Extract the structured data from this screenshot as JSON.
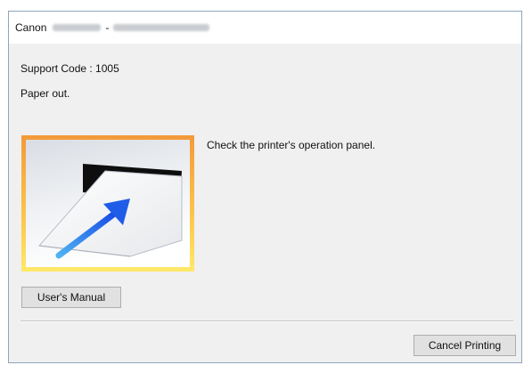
{
  "window": {
    "title_brand": "Canon",
    "title_separator": "-"
  },
  "dialog": {
    "support_code": "Support Code : 1005",
    "status_message": "Paper out.",
    "instruction": "Check the printer's operation panel.",
    "illustration_icon": "paper-feed-icon"
  },
  "buttons": {
    "users_manual": "User's Manual",
    "cancel_printing": "Cancel Printing"
  },
  "colors": {
    "illustration_frame_outer": "#f39a3a",
    "illustration_frame_inner": "#ffe86a",
    "arrow": "#1f5de8"
  }
}
